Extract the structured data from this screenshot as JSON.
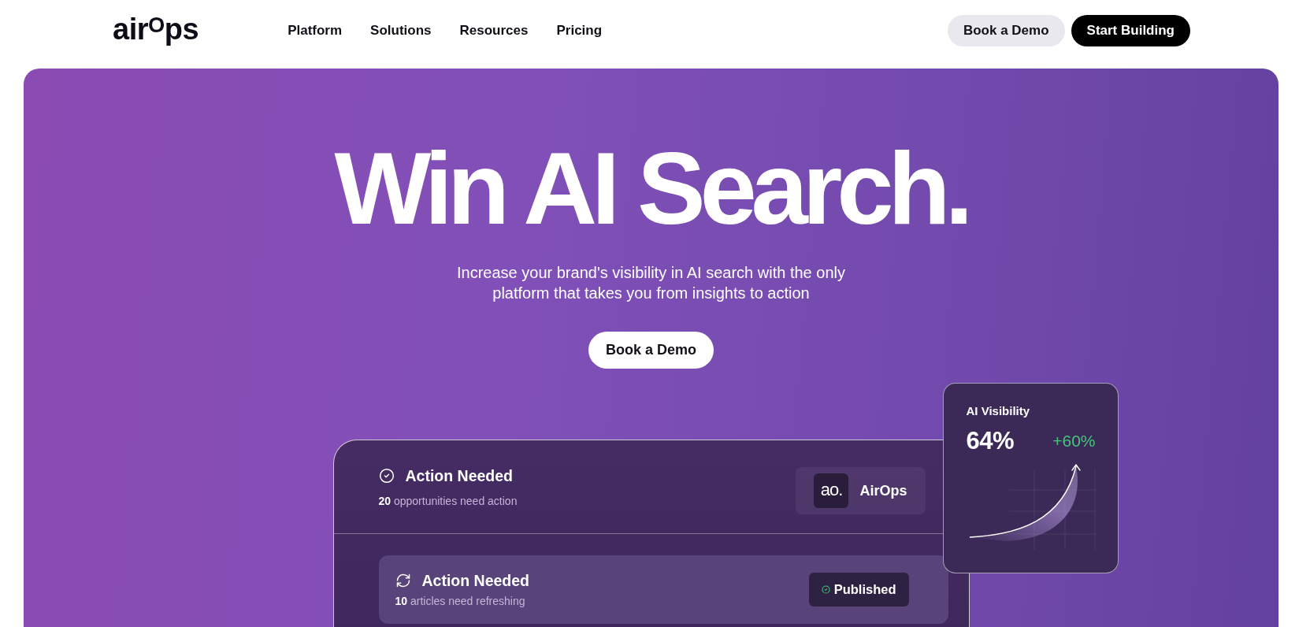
{
  "header": {
    "logo": "air$^{O}$ps",
    "nav": [
      "Platform",
      "Solutions",
      "Resources",
      "Pricing"
    ],
    "buttons": [
      {
        "label": "Book a Demo",
        "kind": "secondary"
      },
      {
        "label": "Start Building",
        "kind": "primary"
      }
    ]
  },
  "hero": {
    "title": "Win AI Search.",
    "subtitle": "Increase your brand's visibility in AI search with the only platform that takes you from insights to action",
    "cta": "Book a Demo"
  },
  "action_card": {
    "summary": {
      "title": "Action Needed",
      "detail": "**20** opportunities need action",
      "brand": {
        "mark": "ao.",
        "name": "AirOps"
      }
    },
    "task": {
      "title": "Action Needed",
      "detail": "**10** articles need refreshing",
      "status": "Published"
    }
  },
  "visibility_card": {
    "title": "AI Visibility",
    "value": "64%",
    "change": "+60%"
  }
}
